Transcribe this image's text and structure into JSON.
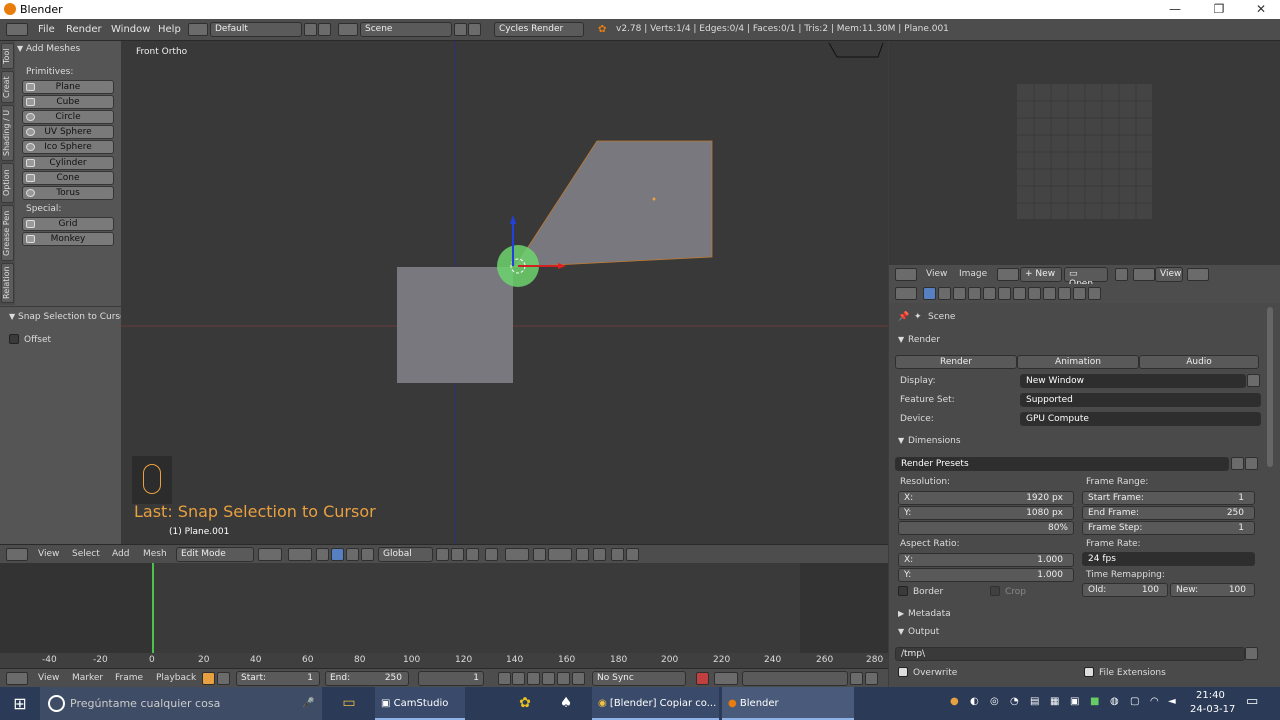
{
  "window": {
    "title": "Blender"
  },
  "infobar": {
    "menus": [
      "File",
      "Render",
      "Window",
      "Help"
    ],
    "layout": "Default",
    "scene": "Scene",
    "engine": "Cycles Render",
    "stats": "v2.78 | Verts:1/4 | Edges:0/4 | Faces:0/1 | Tris:2 | Mem:11.30M | Plane.001"
  },
  "toolshelf": {
    "vtabs": [
      "Tool",
      "Creat",
      "Shading / U",
      "Option",
      "Grease Pen",
      "Relation"
    ],
    "panel_title": "Add Meshes",
    "primitives_label": "Primitives:",
    "primitives": [
      "Plane",
      "Cube",
      "Circle",
      "UV Sphere",
      "Ico Sphere",
      "Cylinder",
      "Cone",
      "Torus"
    ],
    "special_label": "Special:",
    "special": [
      "Grid",
      "Monkey"
    ],
    "operator_title": "Snap Selection to Curso",
    "offset_label": "Offset"
  },
  "viewport": {
    "view_name": "Front Ortho",
    "last_operator": "Last: Snap Selection to Cursor",
    "object_name": "(1) Plane.001"
  },
  "view3d_header": {
    "menus": [
      "View",
      "Select",
      "Add",
      "Mesh"
    ],
    "mode": "Edit Mode",
    "orientation": "Global"
  },
  "timeline": {
    "ticks": [
      "-40",
      "-20",
      "0",
      "20",
      "40",
      "60",
      "80",
      "100",
      "120",
      "140",
      "160",
      "180",
      "200",
      "220",
      "240",
      "260",
      "280"
    ],
    "current_frame": "1",
    "menus": [
      "View",
      "Marker",
      "Frame",
      "Playback"
    ],
    "start_label": "Start:",
    "start_value": "1",
    "end_label": "End:",
    "end_value": "250",
    "sync": "No Sync"
  },
  "image_editor_header": {
    "menus": [
      "View",
      "Image"
    ],
    "new_label": "New",
    "open_label": "Open",
    "view_label": "View"
  },
  "properties": {
    "scene_label": "Scene",
    "render_section": "Render",
    "render_buttons": [
      "Render",
      "Animation",
      "Audio"
    ],
    "display_label": "Display:",
    "display_value": "New Window",
    "feature_label": "Feature Set:",
    "feature_value": "Supported",
    "device_label": "Device:",
    "device_value": "GPU Compute",
    "dimensions_section": "Dimensions",
    "render_presets": "Render Presets",
    "resolution_label": "Resolution:",
    "res_x_label": "X:",
    "res_x": "1920 px",
    "res_y_label": "Y:",
    "res_y": "1080 px",
    "res_pct": "80%",
    "aspect_label": "Aspect Ratio:",
    "aspect_x": "1.000",
    "aspect_y": "1.000",
    "border_label": "Border",
    "crop_label": "Crop",
    "frame_range_label": "Frame Range:",
    "start_frame_label": "Start Frame:",
    "start_frame": "1",
    "end_frame_label": "End Frame:",
    "end_frame": "250",
    "frame_step_label": "Frame Step:",
    "frame_step": "1",
    "frame_rate_label": "Frame Rate:",
    "frame_rate": "24 fps",
    "time_remap_label": "Time Remapping:",
    "old_label": "Old:",
    "old_value": "100",
    "new_label": "New:",
    "new_value": "100",
    "metadata_section": "Metadata",
    "output_section": "Output",
    "output_path": "/tmp\\",
    "overwrite_label": "Overwrite",
    "file_ext_label": "File Extensions"
  },
  "taskbar": {
    "search_placeholder": "Pregúntame cualquier cosa",
    "apps": [
      "CamStudio",
      "[Blender] Copiar co...",
      "Blender"
    ],
    "time": "21:40",
    "date": "24-03-17"
  }
}
